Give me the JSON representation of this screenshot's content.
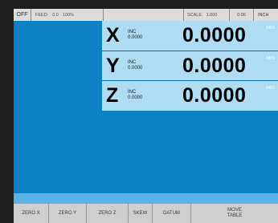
{
  "status": {
    "mode": "OFF",
    "feed_label": "FEED:",
    "feed_value": "0.0",
    "feed_pct": "100%",
    "scale_label": "SCALE:",
    "scale_value": "1.000",
    "time": "0:00",
    "unit": "INCH"
  },
  "axes": [
    {
      "name": "X",
      "inc_label": "INC",
      "inc_value": "0.0000",
      "value": "0.0000",
      "abs_label": "ABS"
    },
    {
      "name": "Y",
      "inc_label": "INC",
      "inc_value": "0.0000",
      "value": "0.0000",
      "abs_label": "ABS"
    },
    {
      "name": "Z",
      "inc_label": "INC",
      "inc_value": "0.0000",
      "value": "0.0000",
      "abs_label": "ABS"
    }
  ],
  "softkeys": {
    "zero_x": "ZERO X",
    "zero_y": "ZERO Y",
    "zero_z": "ZERO Z",
    "skew": "SKEW",
    "datum": "DATUM",
    "move_table": "MOVE\nTABLE"
  },
  "colors": {
    "panel_blue": "#0c82c4",
    "dro_bg": "#aedcf2",
    "status_bg": "#dcdcdc"
  }
}
